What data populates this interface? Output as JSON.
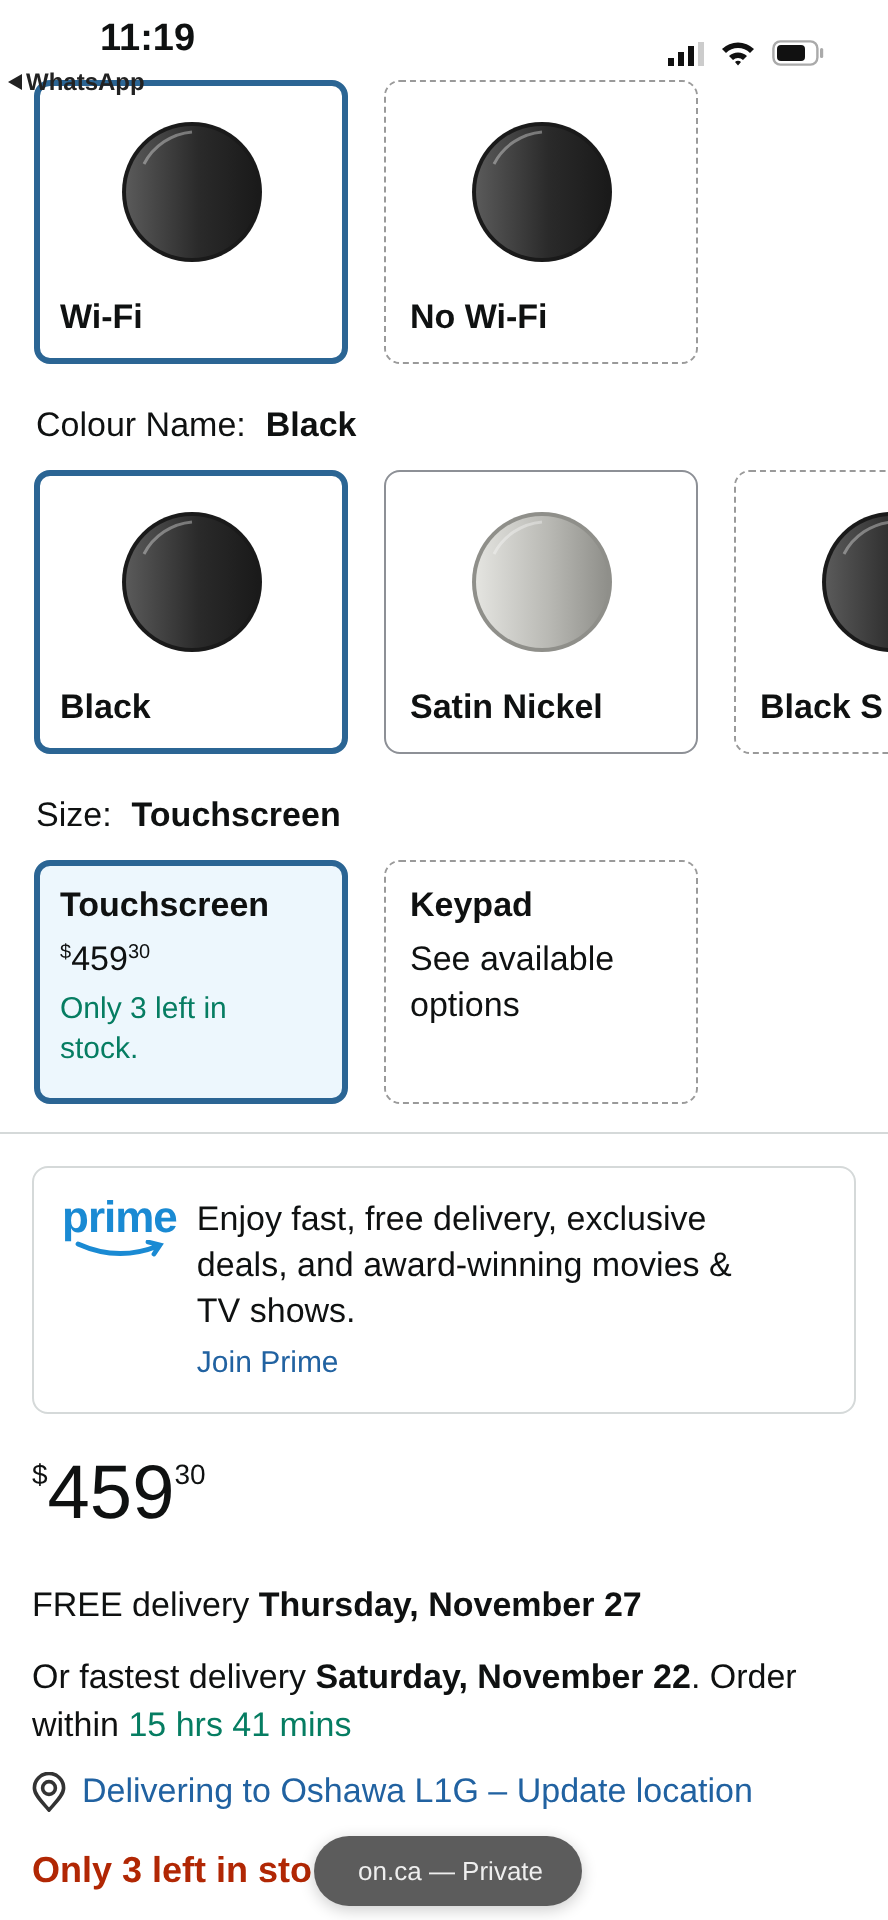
{
  "status_bar": {
    "time": "11:19",
    "back_app": "WhatsApp"
  },
  "style_options": [
    {
      "label": "Wi-Fi",
      "selected": true,
      "kind": "black"
    },
    {
      "label": "No Wi-Fi",
      "selected": false,
      "available": false,
      "kind": "black"
    }
  ],
  "colour": {
    "label": "Colour Name:",
    "value": "Black",
    "options": [
      {
        "label": "Black",
        "selected": true,
        "kind": "black"
      },
      {
        "label": "Satin Nickel",
        "selected": false,
        "available": true,
        "kind": "nickel"
      },
      {
        "label": "Black S",
        "selected": false,
        "available": false,
        "kind": "black"
      }
    ]
  },
  "size": {
    "label": "Size:",
    "value": "Touchscreen",
    "options": [
      {
        "label": "Touchscreen",
        "selected": true,
        "price": {
          "symbol": "$",
          "whole": "459",
          "fraction": "30"
        },
        "stock": "Only 3 left in stock."
      },
      {
        "label": "Keypad",
        "selected": false,
        "available": false,
        "note": "See available options"
      }
    ]
  },
  "prime": {
    "logo": "prime",
    "text": "Enjoy fast, free delivery, exclusive deals, and award-winning movies & TV shows.",
    "link": "Join Prime"
  },
  "price": {
    "symbol": "$",
    "whole": "459",
    "fraction": "30"
  },
  "free_delivery": "FREE delivery **Thursday, November 27**",
  "fastest_delivery": {
    "text": "Or fastest delivery **Saturday, November 22**. Order within",
    "countdown": "15 hrs 41 mins"
  },
  "location": "Delivering to Oshawa L1G – Update location",
  "stock": "Only 3 left in sto",
  "browser_pill": "on.ca — Private"
}
